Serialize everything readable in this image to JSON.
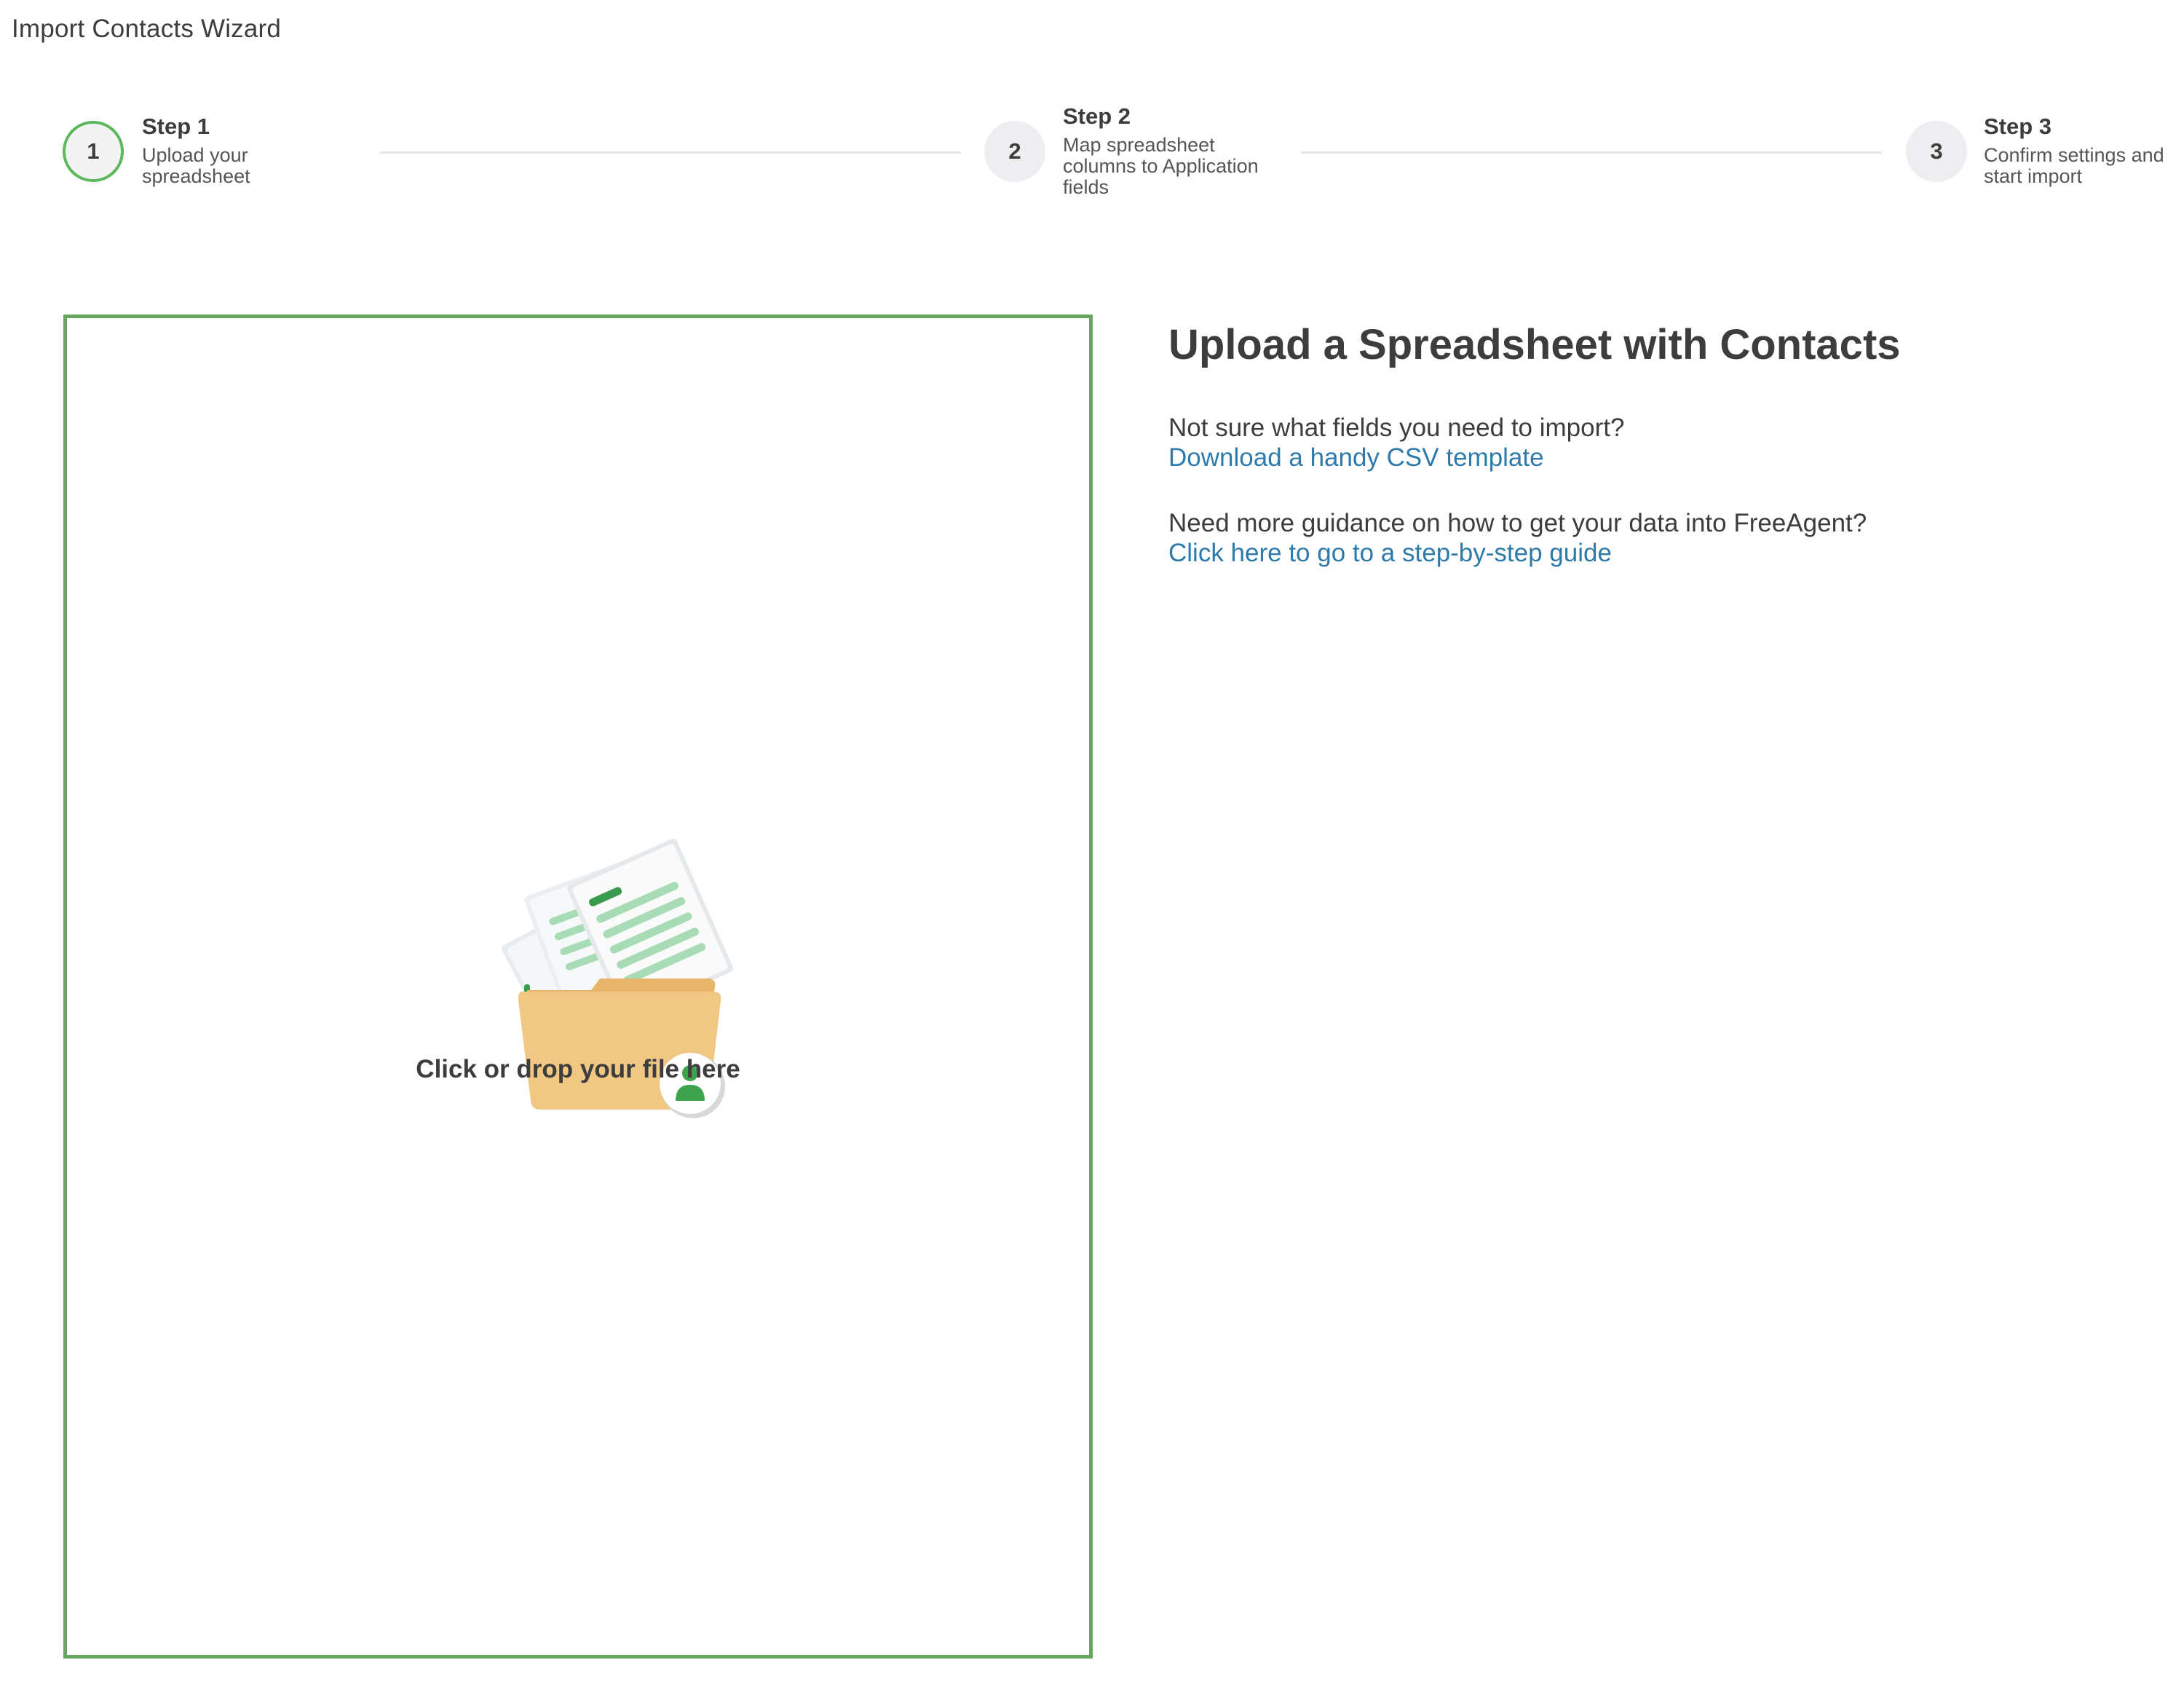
{
  "window": {
    "title": "Import Contacts Wizard"
  },
  "stepper": {
    "steps": [
      {
        "number": "1",
        "heading": "Step 1",
        "description_lines": [
          "Upload your",
          "spreadsheet"
        ],
        "state": "active"
      },
      {
        "number": "2",
        "heading": "Step 2",
        "description_lines": [
          "Map spreadsheet",
          "columns to Application",
          "fields"
        ],
        "state": "inactive"
      },
      {
        "number": "3",
        "heading": "Step 3",
        "description_lines": [
          "Confirm settings and",
          "start import"
        ],
        "state": "inactive"
      }
    ]
  },
  "dropzone": {
    "label": "Click or drop your file here",
    "icon": "folder-with-spreadsheets-and-contact-icon"
  },
  "info": {
    "title": "Upload a Spreadsheet with Contacts",
    "question_1": "Not sure what fields you need to import?",
    "link_1": "Download a handy CSV template",
    "question_2": "Need more guidance on how to get your data into FreeAgent?",
    "link_2": "Click here to go to a step-by-step guide"
  },
  "colors": {
    "accent_green": "#66a45f",
    "active_step_border": "#5cb85c",
    "link_blue": "#2e7bab",
    "text_dark": "#3d3d3d",
    "folder_yellow": "#f0c884"
  }
}
